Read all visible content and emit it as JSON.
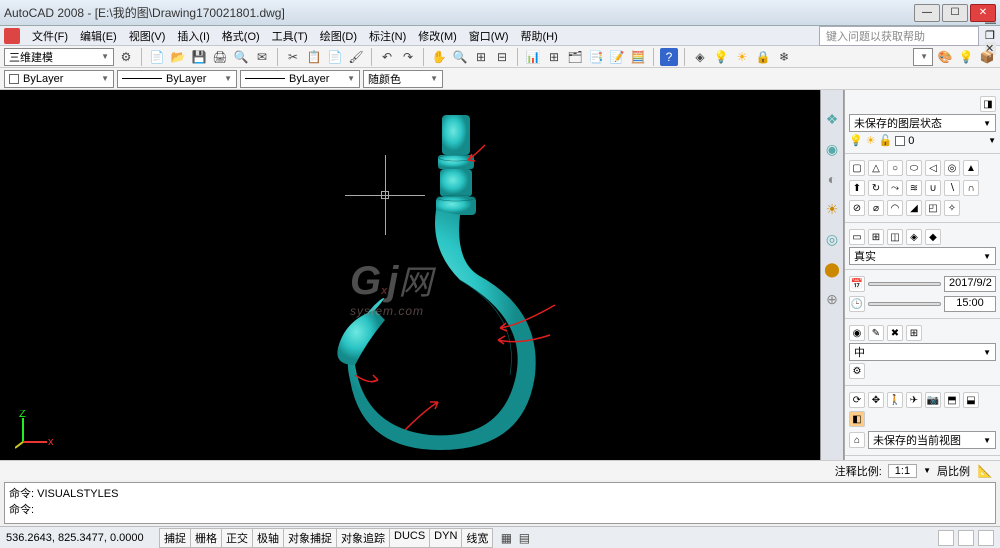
{
  "app": {
    "title": "AutoCAD 2008 - [E:\\我的图\\Drawing170021801.dwg]"
  },
  "menu": {
    "items": [
      "文件(F)",
      "编辑(E)",
      "视图(V)",
      "插入(I)",
      "格式(O)",
      "工具(T)",
      "绘图(D)",
      "标注(N)",
      "修改(M)",
      "窗口(W)",
      "帮助(H)"
    ],
    "help_placeholder": "键入问题以获取帮助"
  },
  "workspace": {
    "selected": "三维建模"
  },
  "layer": {
    "bylayer1": "ByLayer",
    "bylayer2": "ByLayer",
    "bylayer3": "ByLayer",
    "color_label": "随颜色"
  },
  "side": {
    "layer_state": "未保存的图层状态",
    "layer_current": "0",
    "visual_style": "真实",
    "date": "2017/9/2",
    "time": "15:00",
    "material": "中",
    "view_state": "未保存的当前视图"
  },
  "anno": {
    "scale_label": "注释比例:",
    "scale_value": "1:1",
    "scale2_label": "局比例"
  },
  "cmd": {
    "line1": "命令: VISUALSTYLES",
    "line2": "命令:"
  },
  "status": {
    "coords": "536.2643, 825.3477, 0.0000",
    "toggles": [
      "捕捉",
      "栅格",
      "正交",
      "极轴",
      "对象捕捉",
      "对象追踪",
      "DUCS",
      "DYN",
      "线宽"
    ]
  }
}
